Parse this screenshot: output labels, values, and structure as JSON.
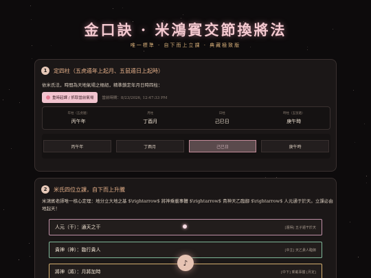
{
  "header": {
    "title": "金口訣 · 米鴻賓交節換將法",
    "subtitle": "唯一標準 · 自下而上立課 · 典藏極致版"
  },
  "section1": {
    "number": "1",
    "title": "定四柱（五虎遁年上起月、五鼠遁日上起時）",
    "description": "依米氏法，時間為天地氣場之樞紐，精準鎖定年月日時四柱：",
    "reset_button": "重時起課 / 抓取當前氣場",
    "current_time": "當前時間：8/23/2026, 12:47:33 PM",
    "pillars": [
      {
        "label": "年柱（五虎遁）",
        "value": "丙午年"
      },
      {
        "label": "月柱",
        "value": "丁酉月"
      },
      {
        "label": "日柱",
        "value": "己巳日"
      },
      {
        "label": "時柱（五鼠遁）",
        "value": "庚午時"
      }
    ],
    "selectors": [
      {
        "label": "丙午年"
      },
      {
        "label": "丁酉月"
      },
      {
        "label": "己巳日"
      },
      {
        "label": "庚午時"
      }
    ]
  },
  "section2": {
    "number": "2",
    "title": "米氏四位立課，自下而上升騰",
    "description": "米鴻賓老師唯一核心定理：地分立大地之基 $\\rightarrow$ 將神乘載事體 $\\rightarrow$ 貴神天乙臨御 $\\rightarrow$ 人元通于於天。立課必由地起天！",
    "rows": [
      {
        "label": "人元（干）：通天之干",
        "tag": "[遁得] 五子遁干於天"
      },
      {
        "label": "貴神（神）：臨行貴人",
        "tag": "[中主] 天乙貴人臨御"
      },
      {
        "label": "將神（將）：月將加時",
        "tag": "[中下] 乘載事體 [月定]"
      }
    ]
  },
  "music": {
    "icon": "♪"
  },
  "colors": {
    "accent_pink": "#f2c4cf",
    "title_pink": "#f4c9d0",
    "gold": "#e5b08a",
    "background": "#0d0b0c"
  }
}
